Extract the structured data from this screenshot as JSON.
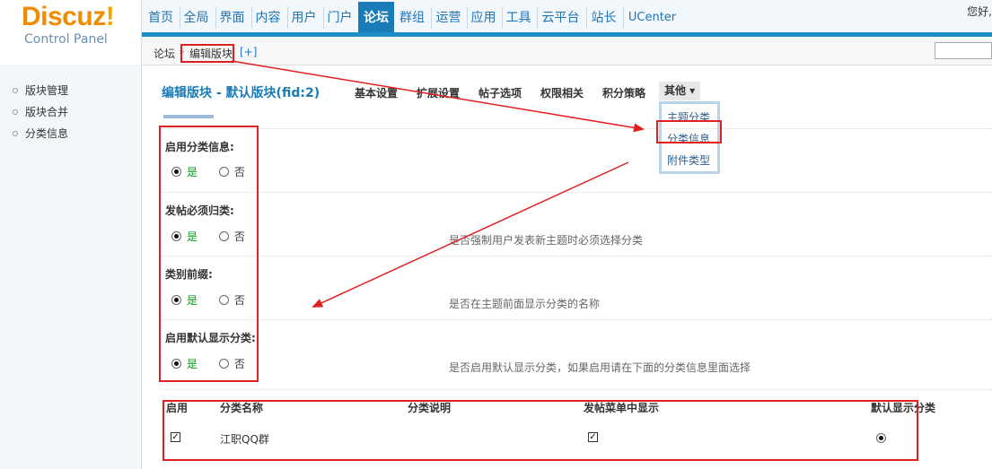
{
  "header": {
    "logo_main": "Discuz",
    "logo_bang": "!",
    "logo_sub": "Control Panel",
    "greeting": "您好,",
    "nav": [
      "首页",
      "全局",
      "界面",
      "内容",
      "用户",
      "门户",
      "论坛",
      "群组",
      "运营",
      "应用",
      "工具",
      "云平台",
      "站长",
      "UCenter"
    ],
    "active_nav": "论坛"
  },
  "breadcrumb": {
    "root": "论坛",
    "arrow": "»",
    "current": "编辑版块",
    "plus": "[+]"
  },
  "sidebar": {
    "items": [
      {
        "label": "版块管理"
      },
      {
        "label": "版块合并"
      },
      {
        "label": "分类信息"
      }
    ]
  },
  "main": {
    "title": "编辑版块 - 默认版块(fid:2)",
    "tabs": [
      "基本设置",
      "扩展设置",
      "帖子选项",
      "权限相关",
      "积分策略"
    ],
    "more": "其他 ▾",
    "dropdown": [
      "主题分类",
      "分类信息",
      "附件类型"
    ]
  },
  "settings": [
    {
      "label": "启用分类信息:",
      "yes": "是",
      "no": "否",
      "selected": "yes",
      "description": ""
    },
    {
      "label": "发帖必须归类:",
      "yes": "是",
      "no": "否",
      "selected": "yes",
      "description": "是否强制用户发表新主题时必须选择分类"
    },
    {
      "label": "类别前缀:",
      "yes": "是",
      "no": "否",
      "selected": "yes",
      "description": "是否在主题前面显示分类的名称"
    },
    {
      "label": "启用默认显示分类:",
      "yes": "是",
      "no": "否",
      "selected": "yes",
      "description": "是否启用默认显示分类，如果启用请在下面的分类信息里面选择"
    }
  ],
  "table": {
    "headers": [
      "启用",
      "分类名称",
      "分类说明",
      "发帖菜单中显示",
      "默认显示分类"
    ],
    "rows": [
      {
        "enabled": true,
        "name": "江职QQ群",
        "description": "",
        "show_in_menu": true,
        "default": true
      }
    ]
  },
  "colors": {
    "accent": "#1a7cb6",
    "annotation": "#e02020",
    "yes_green": "#0a9a1b",
    "logo_orange": "#f08c00"
  }
}
